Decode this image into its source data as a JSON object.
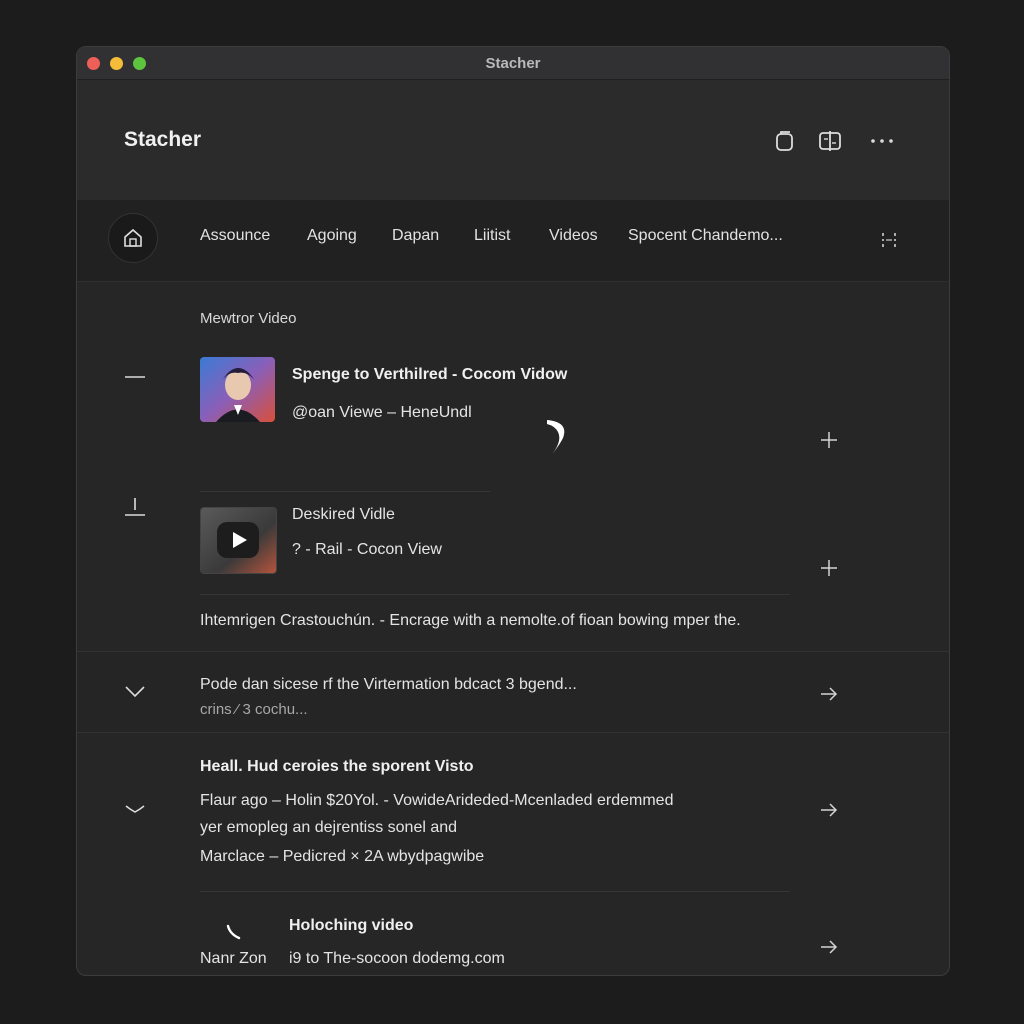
{
  "window": {
    "title": "Stacher"
  },
  "header": {
    "title": "Stacher"
  },
  "nav": {
    "items": [
      "Assounce",
      "Agoing",
      "Dapan",
      "Liitist",
      "Videos",
      "Spocent Chandemo..."
    ]
  },
  "section": {
    "label": "Mewtror Video"
  },
  "videos": [
    {
      "title": "Spenge to Verthilred - Cocom Vidow",
      "subtitle": "@oan Viewe – HeneUndl"
    },
    {
      "title": "Deskired Vidle",
      "subtitle": "? - Rail - Cocon View"
    }
  ],
  "info_line": "Ihtemrigen  Crastouchún. - Encrage with a nemolte.of fioan bowing mper the.",
  "rows": [
    {
      "line1": "Pode dan sicese rf the Virtermation bdcact 3 bgend...",
      "line2": "crins ⁄  3 cochu..."
    },
    {
      "title": "Heall. Hud ceroies the sporent Visto",
      "line1": "Flaur ago – Holin $20Yol. - VowideArideded-Mcenladed erdemmed",
      "line2": "yer emopleg an dejrentiss sonel and",
      "line3": "Marclace – Pedicred × 2A wbydpagwibe"
    },
    {
      "title": "Holoching video",
      "left": "Nanr Zon",
      "line1": "i9 to  The-socoon dodemg.com"
    }
  ],
  "icons": {
    "copy": "copy-icon",
    "split": "split-view-icon",
    "more": "more-icon",
    "home": "home-icon",
    "nav_menu": "grid-menu-icon",
    "plus": "plus-icon",
    "arrow": "arrow-right-icon",
    "collapse": "minus-icon",
    "chevron": "chevron-down-icon"
  },
  "colors": {
    "background": "#1c1c1d",
    "window": "#262627",
    "header": "#2b2b2c",
    "nav": "#212122",
    "text": "#e6e6e6",
    "red_light": "#ee5f57",
    "yellow_light": "#f4bd39",
    "green_light": "#5dc43f"
  }
}
